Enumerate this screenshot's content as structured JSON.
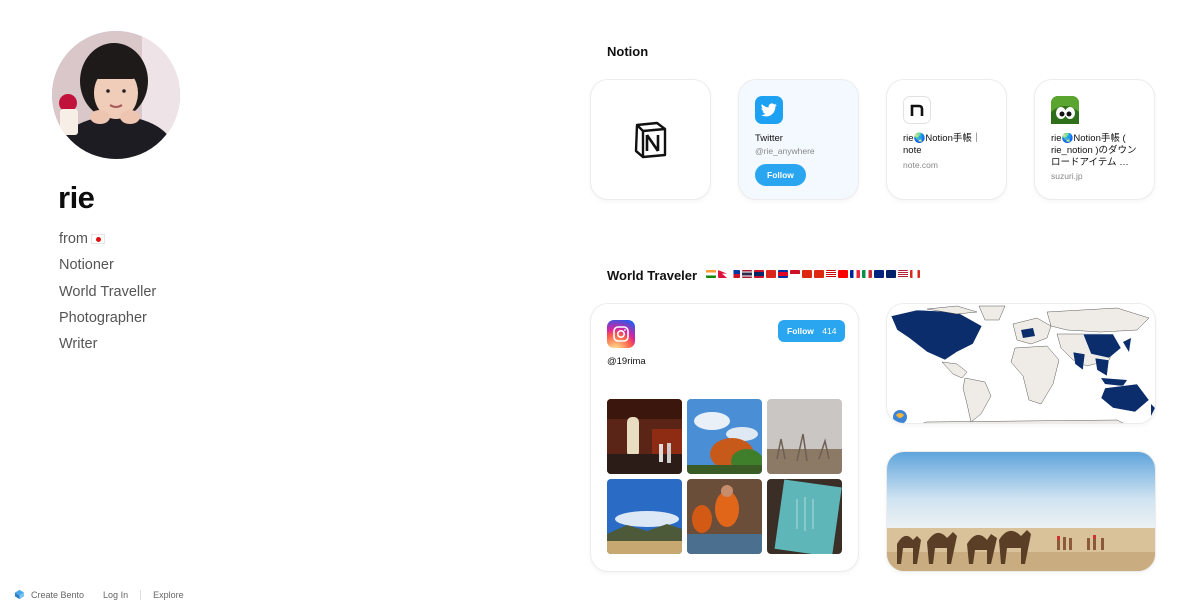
{
  "profile": {
    "name": "rie",
    "bio": [
      "from",
      "Notioner",
      "World Traveller",
      "Photographer",
      "Writer"
    ]
  },
  "notion_section": {
    "title": "Notion",
    "cards": [
      {
        "icon": "notion-logo-icon"
      },
      {
        "icon": "twitter-icon",
        "title": "Twitter",
        "subtitle": "@rie_anywhere",
        "button": "Follow",
        "bg": "#f3f9fe"
      },
      {
        "icon": "note-icon",
        "title": "rie🌏Notion手帳｜note",
        "subtitle": "note.com"
      },
      {
        "icon": "suzuri-icon",
        "title": "rie🌏Notion手帳 ( rie_notion )のダウンロードアイテム …",
        "subtitle": "suzuri.jp"
      }
    ]
  },
  "travel_section": {
    "title": "World Traveler",
    "instagram": {
      "handle": "@19rima",
      "button": "Follow",
      "count": "414"
    }
  },
  "footer": {
    "create": "Create Bento",
    "login": "Log In",
    "explore": "Explore"
  },
  "colors": {
    "accent": "#2aa6f1",
    "twitter": "#1da1f2",
    "map_visited": "#0c2d6b",
    "map_unvisited": "#efebe6"
  }
}
